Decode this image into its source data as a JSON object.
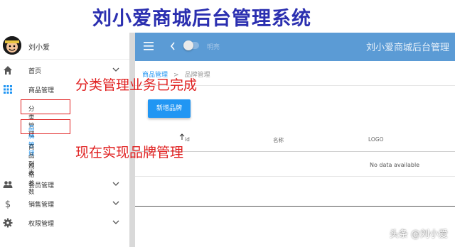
{
  "banner": {
    "title": "刘小爱商城后台管理系统"
  },
  "user": {
    "name": "刘小爱"
  },
  "sidebar": {
    "items": [
      {
        "label": "首页",
        "icon": "home-icon"
      },
      {
        "label": "商品管理",
        "icon": "apps-icon"
      },
      {
        "label": "会员管理",
        "icon": "people-icon"
      },
      {
        "label": "销售管理",
        "icon": "dollar-icon"
      },
      {
        "label": "权限管理",
        "icon": "gear-icon"
      }
    ],
    "sub_items": [
      {
        "label": "分类管理"
      },
      {
        "label": "品牌管理"
      },
      {
        "label": "商品列表"
      },
      {
        "label": "规格参数"
      }
    ]
  },
  "header": {
    "toggle_label": "明亮",
    "app_title": "刘小爱商城后台管理"
  },
  "breadcrumb": {
    "parent": "商品管理",
    "separator": ">",
    "current": "品牌管理"
  },
  "actions": {
    "add_brand": "新增品牌"
  },
  "table": {
    "columns": [
      "id",
      "名称",
      "LOGO"
    ],
    "empty_text": "No data available"
  },
  "annotations": {
    "note1": "分类管理业务已完成",
    "note2": "现在实现品牌管理",
    "watermark": "头条 @刘小爱"
  },
  "colors": {
    "header": "#5b9bd5",
    "accent": "#2196f3",
    "annotation": "#e02020",
    "banner_text": "#2b2fb0"
  }
}
